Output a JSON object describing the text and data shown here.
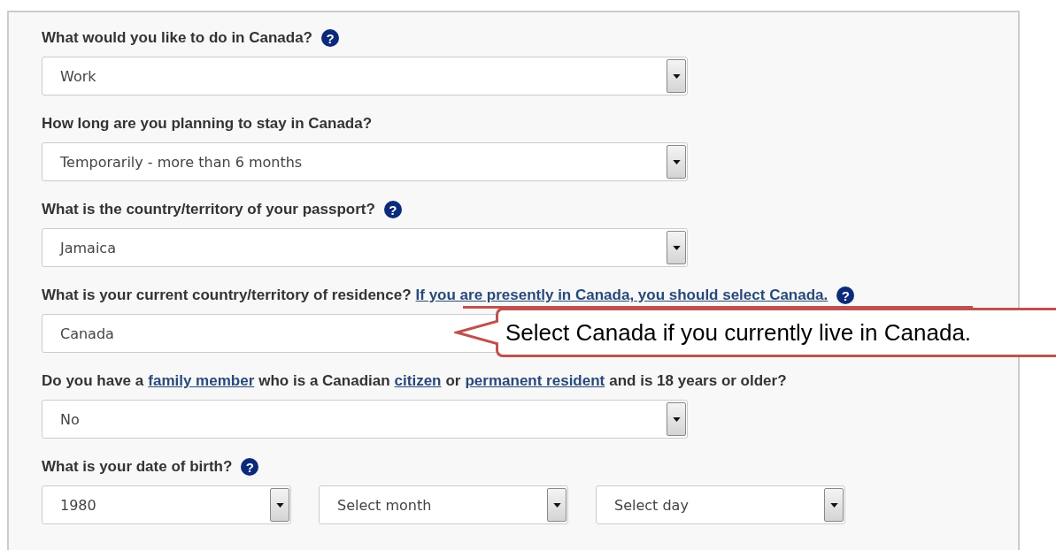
{
  "questions": [
    {
      "label": [
        {
          "kind": "text",
          "text": "What would you like to do in Canada?"
        }
      ],
      "help_icon": "?",
      "selects": [
        {
          "value": "Work",
          "kind": "wide"
        }
      ]
    },
    {
      "label": [
        {
          "kind": "text",
          "text": "How long are you planning to stay in Canada?"
        }
      ],
      "selects": [
        {
          "value": "Temporarily - more than 6 months",
          "kind": "wide"
        }
      ]
    },
    {
      "label": [
        {
          "kind": "text",
          "text": "What is the country/territory of your passport?"
        }
      ],
      "help_icon": "?",
      "selects": [
        {
          "value": "Jamaica",
          "kind": "wide"
        }
      ]
    },
    {
      "label": [
        {
          "kind": "text",
          "text": "What is your current country/territory of residence?"
        },
        {
          "kind": "link",
          "text": "If you are presently in Canada, you should select Canada."
        }
      ],
      "help_icon": "?",
      "selects": [
        {
          "value": "Canada",
          "kind": "wide"
        }
      ]
    },
    {
      "label": [
        {
          "kind": "text",
          "text": "Do you have a"
        },
        {
          "kind": "link",
          "text": "family member"
        },
        {
          "kind": "text",
          "text": "who is a Canadian"
        },
        {
          "kind": "link",
          "text": "citizen"
        },
        {
          "kind": "text",
          "text": "or"
        },
        {
          "kind": "link",
          "text": "permanent resident"
        },
        {
          "kind": "text",
          "text": "and is 18 years or older?"
        }
      ],
      "selects": [
        {
          "value": "No",
          "kind": "wide"
        }
      ]
    },
    {
      "label": [
        {
          "kind": "text",
          "text": "What is your date of birth?"
        }
      ],
      "help_icon": "?",
      "selects": [
        {
          "value": "1980",
          "kind": "small"
        },
        {
          "value": "Select month",
          "kind": "small"
        },
        {
          "value": "Select day",
          "kind": "small"
        }
      ]
    }
  ],
  "callout": {
    "text": "Select Canada if you currently live in Canada."
  }
}
